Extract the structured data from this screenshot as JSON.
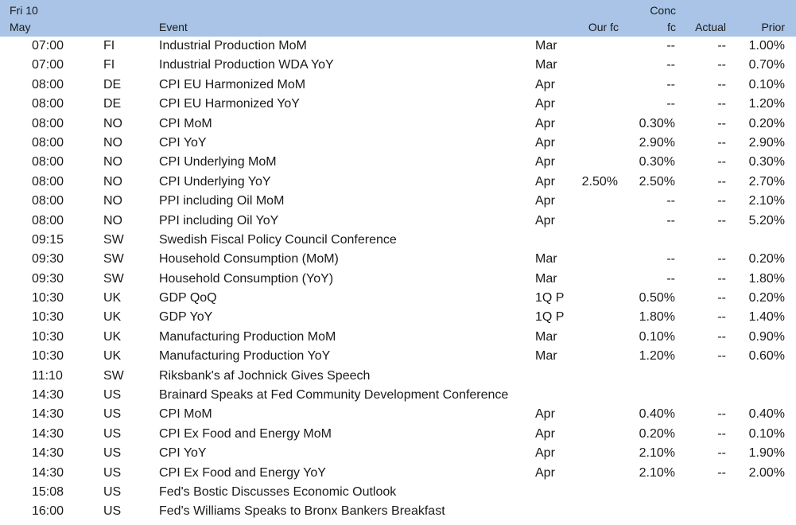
{
  "header": {
    "date_line1": "Fri 10",
    "date_line2": "May",
    "event": "Event",
    "our_fc": "Our fc",
    "conc_line1": "Conc",
    "conc_line2": "fc",
    "actual": "Actual",
    "prior": "Prior"
  },
  "rows": [
    {
      "time": "07:00",
      "country": "FI",
      "event": "Industrial Production MoM",
      "period": "Mar",
      "our_fc": "",
      "conc": "--",
      "actual": "--",
      "prior": "1.00%"
    },
    {
      "time": "07:00",
      "country": "FI",
      "event": "Industrial Production WDA YoY",
      "period": "Mar",
      "our_fc": "",
      "conc": "--",
      "actual": "--",
      "prior": "0.70%"
    },
    {
      "time": "08:00",
      "country": "DE",
      "event": "CPI EU Harmonized MoM",
      "period": "Apr",
      "our_fc": "",
      "conc": "--",
      "actual": "--",
      "prior": "0.10%"
    },
    {
      "time": "08:00",
      "country": "DE",
      "event": "CPI EU Harmonized YoY",
      "period": "Apr",
      "our_fc": "",
      "conc": "--",
      "actual": "--",
      "prior": "1.20%"
    },
    {
      "time": "08:00",
      "country": "NO",
      "event": "CPI MoM",
      "period": "Apr",
      "our_fc": "",
      "conc": "0.30%",
      "actual": "--",
      "prior": "0.20%"
    },
    {
      "time": "08:00",
      "country": "NO",
      "event": "CPI YoY",
      "period": "Apr",
      "our_fc": "",
      "conc": "2.90%",
      "actual": "--",
      "prior": "2.90%"
    },
    {
      "time": "08:00",
      "country": "NO",
      "event": "CPI Underlying MoM",
      "period": "Apr",
      "our_fc": "",
      "conc": "0.30%",
      "actual": "--",
      "prior": "0.30%"
    },
    {
      "time": "08:00",
      "country": "NO",
      "event": "CPI Underlying YoY",
      "period": "Apr",
      "our_fc": "2.50%",
      "conc": "2.50%",
      "actual": "--",
      "prior": "2.70%"
    },
    {
      "time": "08:00",
      "country": "NO",
      "event": "PPI including Oil MoM",
      "period": "Apr",
      "our_fc": "",
      "conc": "--",
      "actual": "--",
      "prior": "2.10%"
    },
    {
      "time": "08:00",
      "country": "NO",
      "event": "PPI including Oil YoY",
      "period": "Apr",
      "our_fc": "",
      "conc": "--",
      "actual": "--",
      "prior": "5.20%"
    },
    {
      "time": "09:15",
      "country": "SW",
      "event": "Swedish Fiscal Policy Council Conference",
      "period": "",
      "our_fc": "",
      "conc": "",
      "actual": "",
      "prior": ""
    },
    {
      "time": "09:30",
      "country": "SW",
      "event": "Household Consumption (MoM)",
      "period": "Mar",
      "our_fc": "",
      "conc": "--",
      "actual": "--",
      "prior": "0.20%"
    },
    {
      "time": "09:30",
      "country": "SW",
      "event": "Household Consumption (YoY)",
      "period": "Mar",
      "our_fc": "",
      "conc": "--",
      "actual": "--",
      "prior": "1.80%"
    },
    {
      "time": "10:30",
      "country": "UK",
      "event": "GDP QoQ",
      "period": "1Q P",
      "our_fc": "",
      "conc": "0.50%",
      "actual": "--",
      "prior": "0.20%"
    },
    {
      "time": "10:30",
      "country": "UK",
      "event": "GDP YoY",
      "period": "1Q P",
      "our_fc": "",
      "conc": "1.80%",
      "actual": "--",
      "prior": "1.40%"
    },
    {
      "time": "10:30",
      "country": "UK",
      "event": "Manufacturing Production MoM",
      "period": "Mar",
      "our_fc": "",
      "conc": "0.10%",
      "actual": "--",
      "prior": "0.90%"
    },
    {
      "time": "10:30",
      "country": "UK",
      "event": "Manufacturing Production YoY",
      "period": "Mar",
      "our_fc": "",
      "conc": "1.20%",
      "actual": "--",
      "prior": "0.60%"
    },
    {
      "time": "11:10",
      "country": "SW",
      "event": "Riksbank's af Jochnick Gives Speech",
      "period": "",
      "our_fc": "",
      "conc": "",
      "actual": "",
      "prior": ""
    },
    {
      "time": "14:30",
      "country": "US",
      "event": "Brainard Speaks at Fed Community Development Conference",
      "period": "",
      "our_fc": "",
      "conc": "",
      "actual": "",
      "prior": ""
    },
    {
      "time": "14:30",
      "country": "US",
      "event": "CPI MoM",
      "period": "Apr",
      "our_fc": "",
      "conc": "0.40%",
      "actual": "--",
      "prior": "0.40%"
    },
    {
      "time": "14:30",
      "country": "US",
      "event": "CPI Ex Food and Energy MoM",
      "period": "Apr",
      "our_fc": "",
      "conc": "0.20%",
      "actual": "--",
      "prior": "0.10%"
    },
    {
      "time": "14:30",
      "country": "US",
      "event": "CPI YoY",
      "period": "Apr",
      "our_fc": "",
      "conc": "2.10%",
      "actual": "--",
      "prior": "1.90%"
    },
    {
      "time": "14:30",
      "country": "US",
      "event": "CPI Ex Food and Energy YoY",
      "period": "Apr",
      "our_fc": "",
      "conc": "2.10%",
      "actual": "--",
      "prior": "2.00%"
    },
    {
      "time": "15:08",
      "country": "US",
      "event": "Fed's Bostic Discusses Economic Outlook",
      "period": "",
      "our_fc": "",
      "conc": "",
      "actual": "",
      "prior": ""
    },
    {
      "time": "16:00",
      "country": "US",
      "event": "Fed's Williams Speaks to Bronx Bankers Breakfast",
      "period": "",
      "our_fc": "",
      "conc": "",
      "actual": "",
      "prior": ""
    }
  ]
}
